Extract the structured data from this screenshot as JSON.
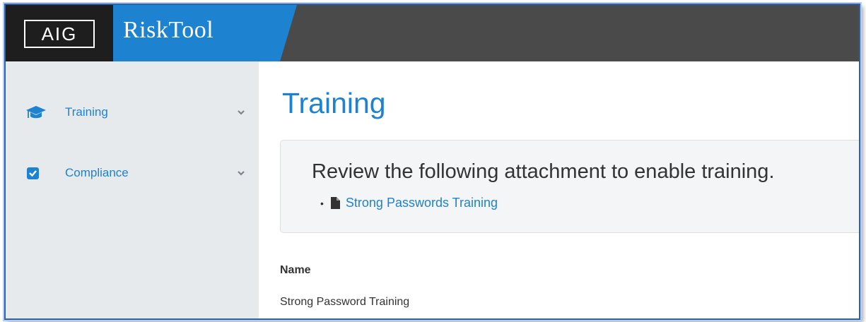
{
  "header": {
    "logo_text": "AIG",
    "product_name": "RiskTool"
  },
  "sidebar": {
    "items": [
      {
        "label": "Training",
        "icon": "graduation-cap-icon"
      },
      {
        "label": "Compliance",
        "icon": "checkbox-checked-icon"
      }
    ]
  },
  "main": {
    "title": "Training",
    "notice": {
      "text": "Review the following attachment to enable training.",
      "bullet": "•",
      "attachment_label": "Strong Passwords Training"
    },
    "fields": [
      {
        "label": "Name",
        "value": "Strong Password Training"
      }
    ]
  },
  "colors": {
    "accent": "#1d82d0",
    "topbar": "#4a4a4a",
    "sidebar_bg": "#e7eaed"
  }
}
